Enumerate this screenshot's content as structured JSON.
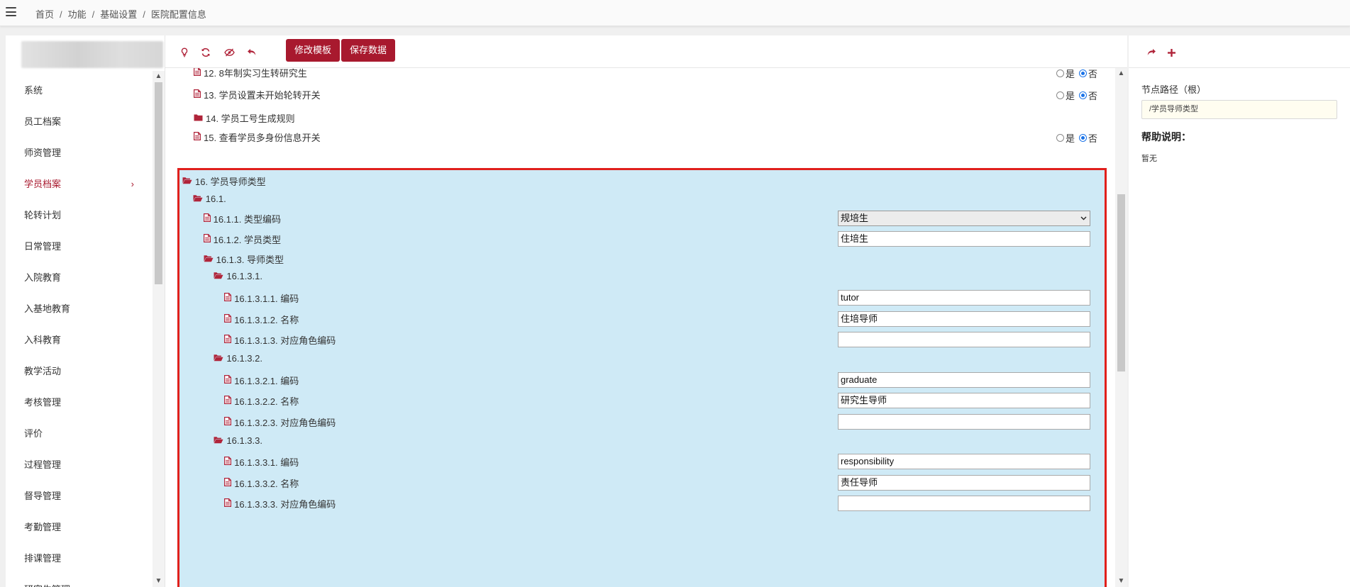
{
  "breadcrumb": {
    "items": [
      "首页",
      "功能",
      "基础设置",
      "医院配置信息"
    ],
    "sep": "/"
  },
  "sidebar": {
    "items": [
      {
        "label": "系统"
      },
      {
        "label": "员工档案"
      },
      {
        "label": "师资管理"
      },
      {
        "label": "学员档案",
        "active": true,
        "chevron": "›"
      },
      {
        "label": "轮转计划"
      },
      {
        "label": "日常管理"
      },
      {
        "label": "入院教育"
      },
      {
        "label": "入基地教育"
      },
      {
        "label": "入科教育"
      },
      {
        "label": "教学活动"
      },
      {
        "label": "考核管理"
      },
      {
        "label": "评价"
      },
      {
        "label": "过程管理"
      },
      {
        "label": "督导管理"
      },
      {
        "label": "考勤管理"
      },
      {
        "label": "排课管理"
      },
      {
        "label": "研究生管理"
      }
    ]
  },
  "toolbar": {
    "icons": [
      "bulb-icon",
      "refresh-icon",
      "eye-slash-icon",
      "undo-icon"
    ],
    "edit_template_label": "修改模板",
    "save_data_label": "保存数据"
  },
  "tree_top": [
    {
      "label": "12. 8年制实习生转研究生",
      "icon": "file-icon",
      "radio": {
        "yes": "是",
        "no": "否",
        "selected": "no"
      }
    },
    {
      "label": "13. 学员设置未开始轮转开关",
      "icon": "file-icon",
      "radio": {
        "yes": "是",
        "no": "否",
        "selected": "no"
      }
    },
    {
      "label": "14. 学员工号生成规则",
      "icon": "folder-icon"
    },
    {
      "label": "15. 查看学员多身份信息开关",
      "icon": "file-icon",
      "radio": {
        "yes": "是",
        "no": "否",
        "selected": "no"
      }
    }
  ],
  "tree_highlight": [
    {
      "label": "16. 学员导师类型",
      "icon": "folder-open-icon"
    },
    {
      "label": "16.1.",
      "icon": "folder-open-icon"
    },
    {
      "label": "16.1.1. 类型编码",
      "icon": "file-icon",
      "select": "规培生"
    },
    {
      "label": "16.1.2. 学员类型",
      "icon": "file-icon",
      "value": "住培生"
    },
    {
      "label": "16.1.3. 导师类型",
      "icon": "folder-open-icon"
    },
    {
      "label": "16.1.3.1.",
      "icon": "folder-open-icon"
    },
    {
      "label": "16.1.3.1.1. 编码",
      "icon": "file-icon",
      "value": "tutor"
    },
    {
      "label": "16.1.3.1.2. 名称",
      "icon": "file-icon",
      "value": "住培导师"
    },
    {
      "label": "16.1.3.1.3. 对应角色编码",
      "icon": "file-icon",
      "value": ""
    },
    {
      "label": "16.1.3.2.",
      "icon": "folder-open-icon"
    },
    {
      "label": "16.1.3.2.1. 编码",
      "icon": "file-icon",
      "value": "graduate"
    },
    {
      "label": "16.1.3.2.2. 名称",
      "icon": "file-icon",
      "value": "研究生导师"
    },
    {
      "label": "16.1.3.2.3. 对应角色编码",
      "icon": "file-icon",
      "value": ""
    },
    {
      "label": "16.1.3.3.",
      "icon": "folder-open-icon"
    },
    {
      "label": "16.1.3.3.1. 编码",
      "icon": "file-icon",
      "value": "responsibility"
    },
    {
      "label": "16.1.3.3.2. 名称",
      "icon": "file-icon",
      "value": "责任导师"
    },
    {
      "label": "16.1.3.3.3. 对应角色编码",
      "icon": "file-icon",
      "value": ""
    }
  ],
  "right_panel": {
    "toolbar_icons": [
      "forward-icon",
      "plus-icon"
    ],
    "node_path_label": "节点路径（根）",
    "node_path_value": "/学员导师类型",
    "help_title": "帮助说明：",
    "help_text": "暂无"
  },
  "colors": {
    "accent": "#a8192e",
    "highlight_bg": "#cfeaf6",
    "highlight_border": "#e0201c",
    "radio_blue": "#1a73e8"
  }
}
